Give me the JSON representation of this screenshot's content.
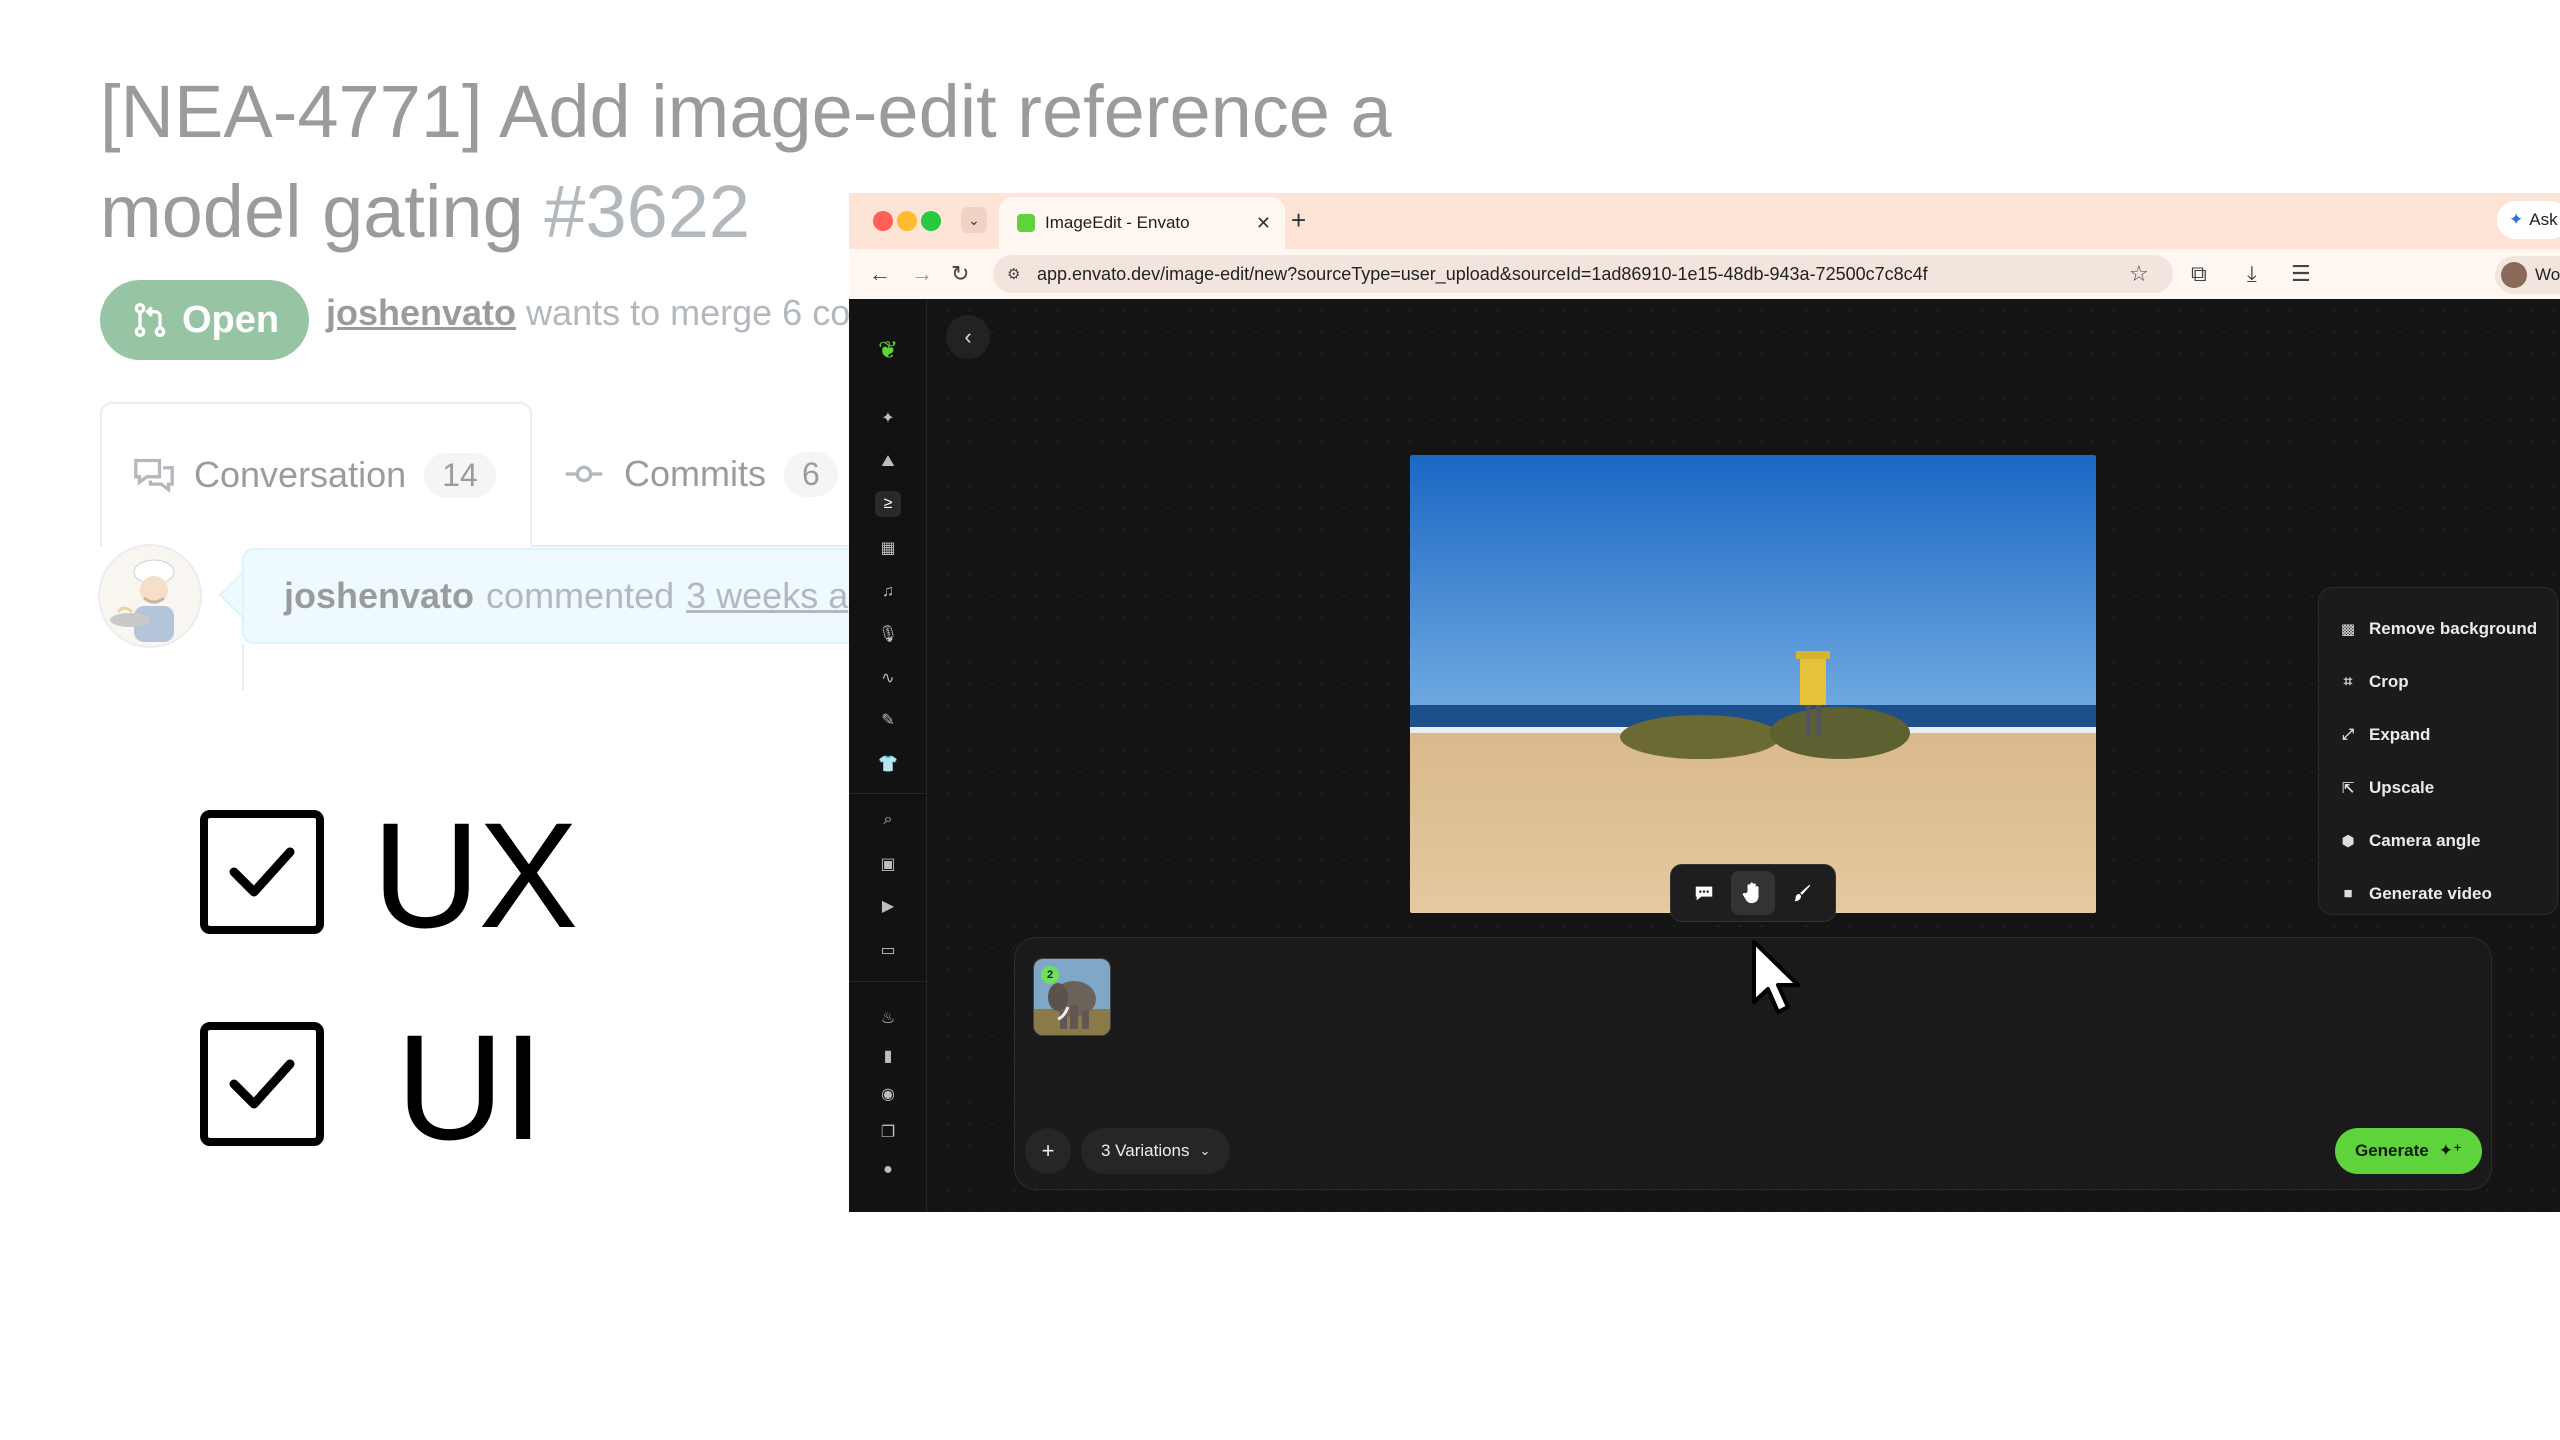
{
  "github": {
    "title": "[NEA-4771] Add image-edit reference a",
    "title_line2": "model gating",
    "pr_number": "#3622",
    "status_badge": "Open",
    "author": "joshenvato",
    "merge_text": "wants to merge 6 co",
    "tabs": [
      {
        "label": "Conversation",
        "count": "14"
      },
      {
        "label": "Commits",
        "count": "6"
      }
    ],
    "comment": {
      "author": "joshenvato",
      "action": "commented",
      "time": "3 weeks a"
    }
  },
  "checklist": [
    {
      "label": "UX",
      "checked": true
    },
    {
      "label": "UI",
      "checked": true
    }
  ],
  "browser": {
    "tab_title": "ImageEdit - Envato",
    "url": "app.envato.dev/image-edit/new?sourceType=user_upload&sourceId=1ad86910-1e15-48db-943a-72500c7c8c4f",
    "ask_label": "Ask",
    "profile_label": "Wor"
  },
  "app": {
    "tools": [
      {
        "label": "Remove background",
        "icon": "remove-bg-icon"
      },
      {
        "label": "Crop",
        "icon": "crop-icon"
      },
      {
        "label": "Expand",
        "icon": "expand-icon"
      },
      {
        "label": "Upscale",
        "icon": "upscale-icon"
      },
      {
        "label": "Camera angle",
        "icon": "camera-angle-icon"
      },
      {
        "label": "Generate video",
        "icon": "generate-video-icon"
      }
    ],
    "reference_count": "2",
    "variations_label": "3 Variations",
    "generate_label": "Generate",
    "accent_color": "#5fd33c"
  }
}
